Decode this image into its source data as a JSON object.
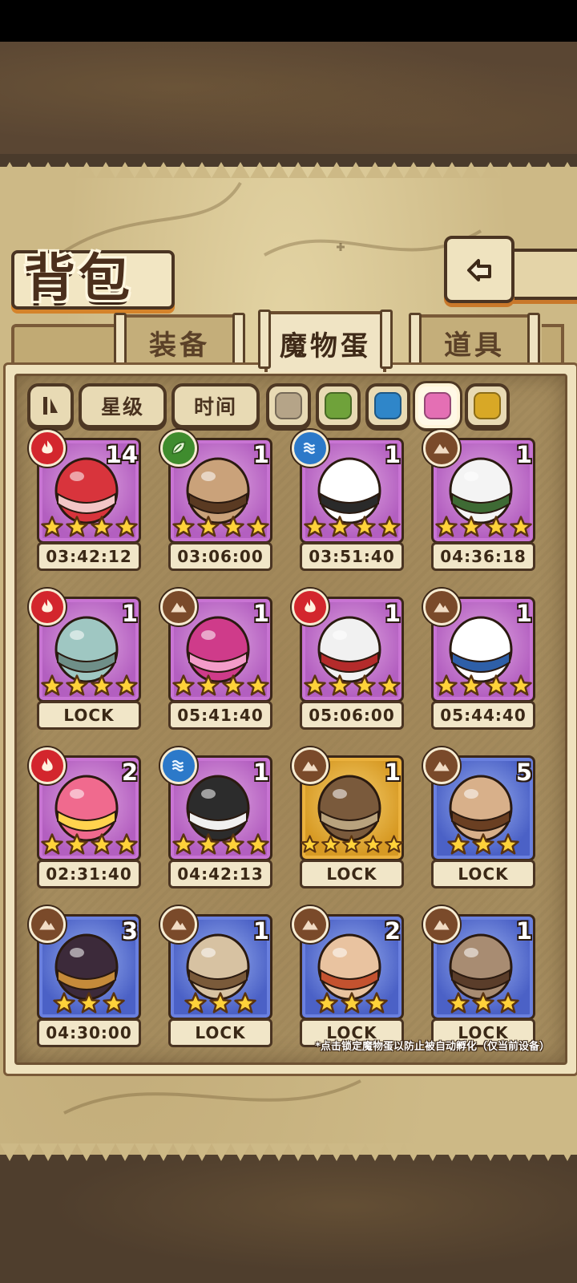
{
  "title": "背包",
  "tabs": [
    {
      "label": "装备",
      "active": false
    },
    {
      "label": "魔物蛋",
      "active": true
    },
    {
      "label": "道具",
      "active": false
    }
  ],
  "filters": {
    "sort_icon": "sort-toggle-icon",
    "star_label": "星级",
    "time_label": "时间",
    "swatches": [
      {
        "color": "#b5a488",
        "selected": false
      },
      {
        "color": "#6fa23a",
        "selected": false
      },
      {
        "color": "#2f86c9",
        "selected": false
      },
      {
        "color": "#e46fb4",
        "selected": true
      },
      {
        "color": "#d8a826",
        "selected": false
      }
    ]
  },
  "eggs": [
    {
      "element": "fire",
      "count": "14",
      "stars": 4,
      "rarity": "purple",
      "label": "03:42:12"
    },
    {
      "element": "leaf",
      "count": "1",
      "stars": 4,
      "rarity": "purple",
      "label": "03:06:00"
    },
    {
      "element": "water",
      "count": "1",
      "stars": 4,
      "rarity": "purple",
      "label": "03:51:40"
    },
    {
      "element": "earth",
      "count": "1",
      "stars": 4,
      "rarity": "purple",
      "label": "04:36:18"
    },
    {
      "element": "fire",
      "count": "1",
      "stars": 4,
      "rarity": "purple",
      "label": "LOCK"
    },
    {
      "element": "earth",
      "count": "1",
      "stars": 4,
      "rarity": "purple",
      "label": "05:41:40"
    },
    {
      "element": "fire",
      "count": "1",
      "stars": 4,
      "rarity": "purple",
      "label": "05:06:00"
    },
    {
      "element": "earth",
      "count": "1",
      "stars": 4,
      "rarity": "purple",
      "label": "05:44:40"
    },
    {
      "element": "fire",
      "count": "2",
      "stars": 4,
      "rarity": "purple",
      "label": "02:31:40"
    },
    {
      "element": "water",
      "count": "1",
      "stars": 4,
      "rarity": "purple",
      "label": "04:42:13"
    },
    {
      "element": "earth",
      "count": "1",
      "stars": 5,
      "rarity": "gold",
      "label": "LOCK"
    },
    {
      "element": "earth",
      "count": "5",
      "stars": 3,
      "rarity": "blue",
      "label": "LOCK"
    },
    {
      "element": "earth",
      "count": "3",
      "stars": 3,
      "rarity": "blue",
      "label": "04:30:00"
    },
    {
      "element": "earth",
      "count": "1",
      "stars": 3,
      "rarity": "blue",
      "label": "LOCK"
    },
    {
      "element": "earth",
      "count": "2",
      "stars": 3,
      "rarity": "blue",
      "label": "LOCK"
    },
    {
      "element": "earth",
      "count": "1",
      "stars": 3,
      "rarity": "blue",
      "label": "LOCK"
    }
  ],
  "footnote": "*点击锁定魔物蛋以防止被自动孵化（仅当前设备）"
}
